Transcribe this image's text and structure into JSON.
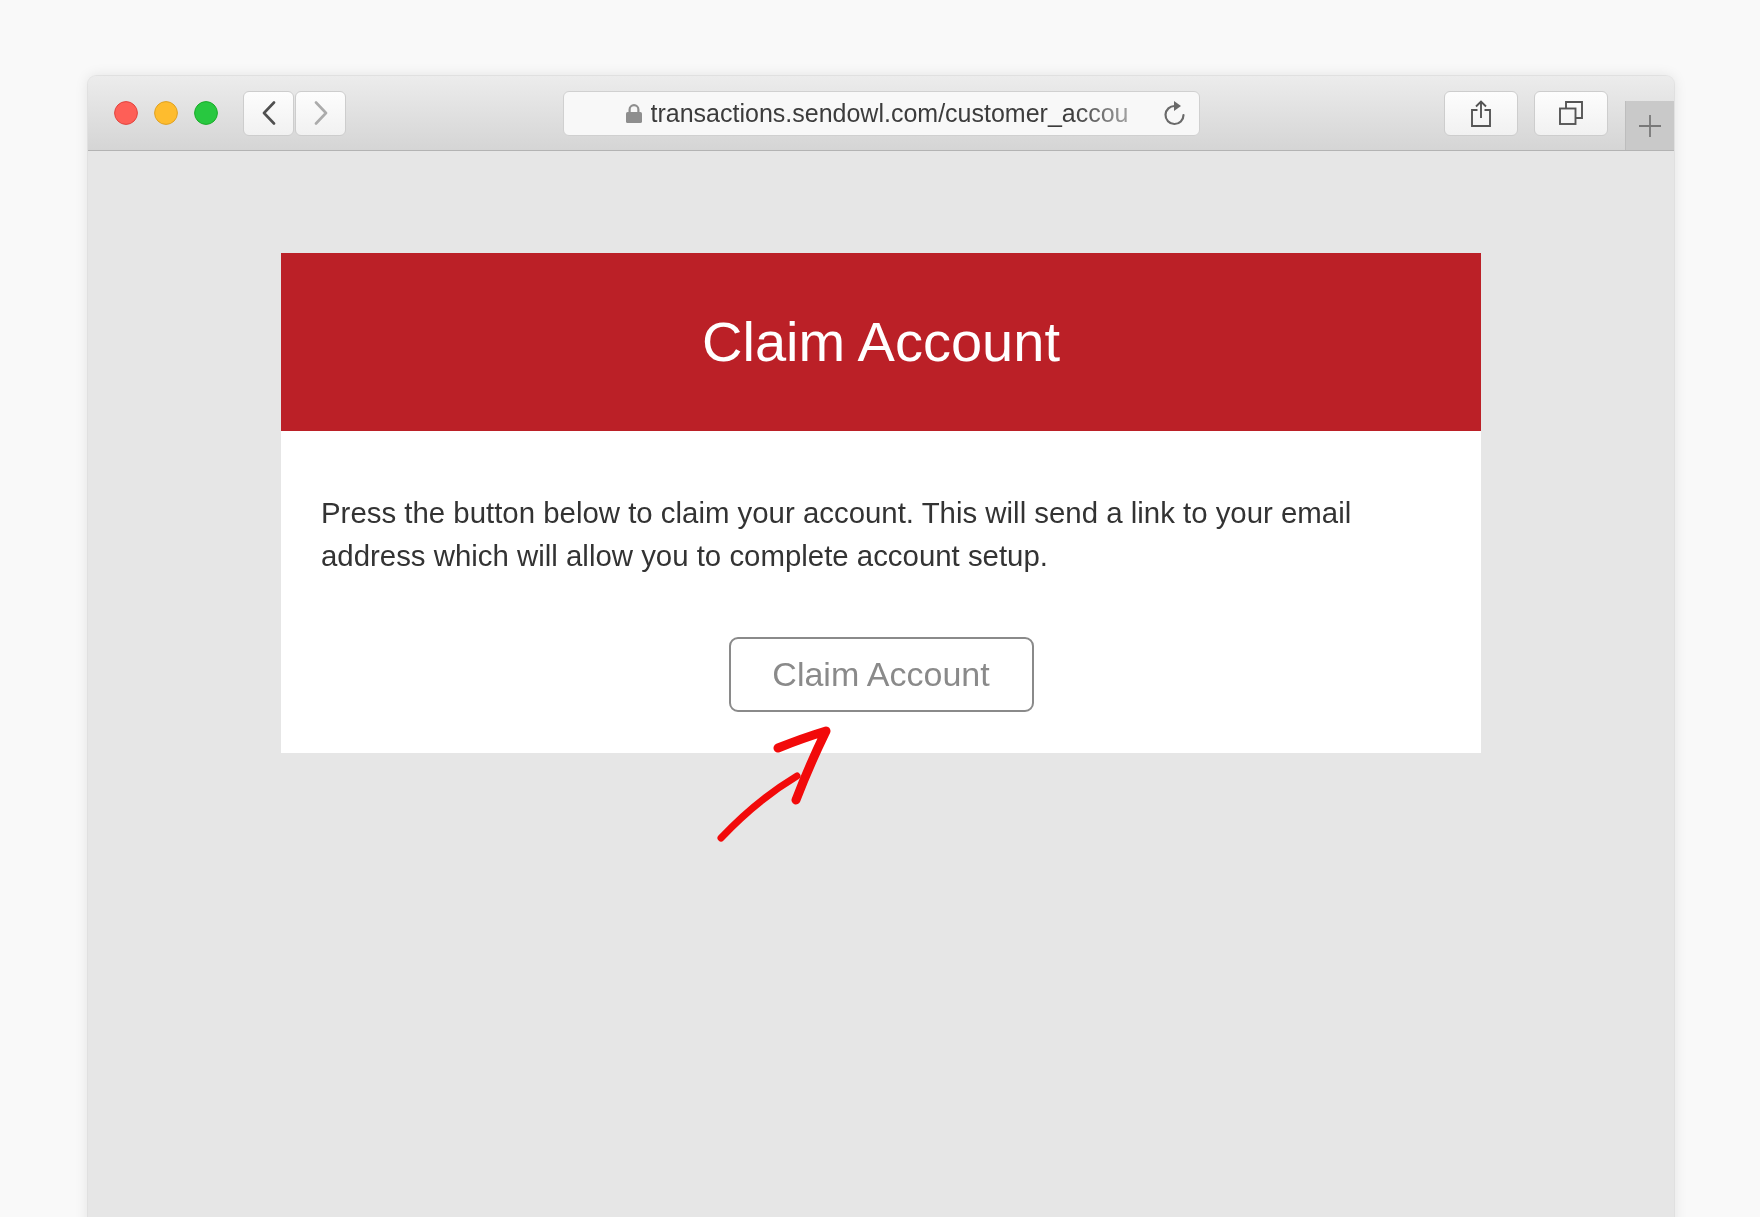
{
  "browser": {
    "navigation": [
      {
        "kind": "back",
        "disabled": false
      },
      {
        "kind": "forward",
        "disabled": true
      }
    ],
    "address_bar": {
      "secure": true,
      "url": "transactions.sendowl.com/customer_accou"
    }
  },
  "page": {
    "header": {
      "title": "Claim Account"
    },
    "message": "Press the button below to claim your account. This will send a link to your email address which will allow you to complete account setup.",
    "button": {
      "label": "Claim Account"
    }
  }
}
